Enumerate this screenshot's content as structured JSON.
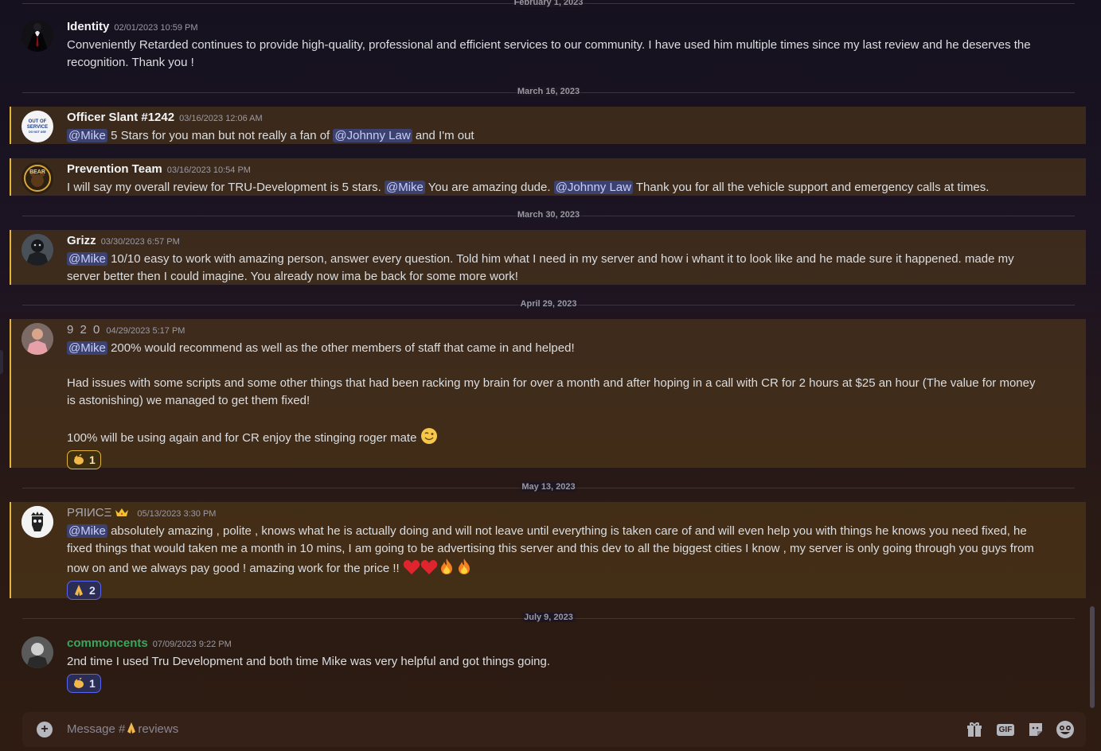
{
  "chat": {
    "dividers": [
      "February 1, 2023",
      "March 16, 2023",
      "March 30, 2023",
      "April 29, 2023",
      "May 13, 2023",
      "July 9, 2023"
    ],
    "messages": [
      {
        "author": "Identity",
        "timestamp": "02/01/2023 10:59 PM",
        "text": "Conveniently Retarded continues to provide high-quality, professional and efficient services to our community. I have used him multiple times since my last review and he deserves the recognition. Thank you  !"
      },
      {
        "author": "Officer Slant #1242",
        "timestamp": "03/16/2023 12:06 AM",
        "mention1": "@Mike",
        "text1": " 5 Stars for you man but not really a fan of ",
        "mention2": "@Johnny Law",
        "text2": " and I'm out",
        "avatar_text": [
          "OUT OF",
          "SERVICE",
          "DO NOT USE"
        ]
      },
      {
        "author": "Prevention Team",
        "timestamp": "03/16/2023 10:54 PM",
        "text1": "I will say my overall review for TRU-Development is 5 stars. ",
        "mention1": "@Mike",
        "text2": " You are amazing dude. ",
        "mention2": "@Johnny Law",
        "text3": " Thank you for all the vehicle support and emergency calls at times.",
        "avatar_text": "BEAR"
      },
      {
        "author": "Grizz",
        "timestamp": "03/30/2023 6:57 PM",
        "mention1": "@Mike",
        "text": " 10/10 easy to work with amazing person, answer every question. Told him what I need in my server and how i whant it to look like and he made sure it happened. made my server better then I could imagine. You already now ima be back for some more work!"
      },
      {
        "author": "9 2 0",
        "timestamp": "04/29/2023 5:17 PM",
        "mention1": "@Mike",
        "p1": " 200% would recommend as well as the other members of staff that came in and helped!",
        "p2": "Had issues with some scripts and some other things that had been racking my brain for over a month and after hoping in a call with CR for 2 hours at $25 an hour (The value for money is astonishing) we managed to get them fixed!",
        "p3": "100% will be using again and for CR enjoy the stinging roger mate",
        "reaction_count": "1"
      },
      {
        "author": "PЯIИCΞ",
        "timestamp": "05/13/2023 3:30 PM",
        "mention1": "@Mike",
        "text": " absolutely amazing , polite , knows what he is actually doing and will not leave until everything is taken care of and will even help you with things he knows you need fixed,  he fixed things that would taken me a month in 10 mins, I am going to be advertising this server and this dev to all the biggest cities I know , my server is only going through you guys from now on and we always pay good ! amazing work for the price !! ",
        "reaction_count": "2"
      },
      {
        "author": "commoncents",
        "timestamp": "07/09/2023 9:22 PM",
        "text": "2nd time I used Tru Development and both time Mike was very helpful and got things going.",
        "reaction_count": "1"
      }
    ]
  },
  "composer": {
    "placeholder_prefix": "Message #",
    "placeholder_channel": "reviews"
  },
  "icons": {
    "add": "plus-circle-icon",
    "gift": "gift-icon",
    "gif": "GIF",
    "sticker": "sticker-icon",
    "emoji": "emoji-icon"
  },
  "colors": {
    "accent_highlight": "#e4b33b",
    "mention_bg": "#3c4270",
    "username_green": "#3ba55d"
  }
}
